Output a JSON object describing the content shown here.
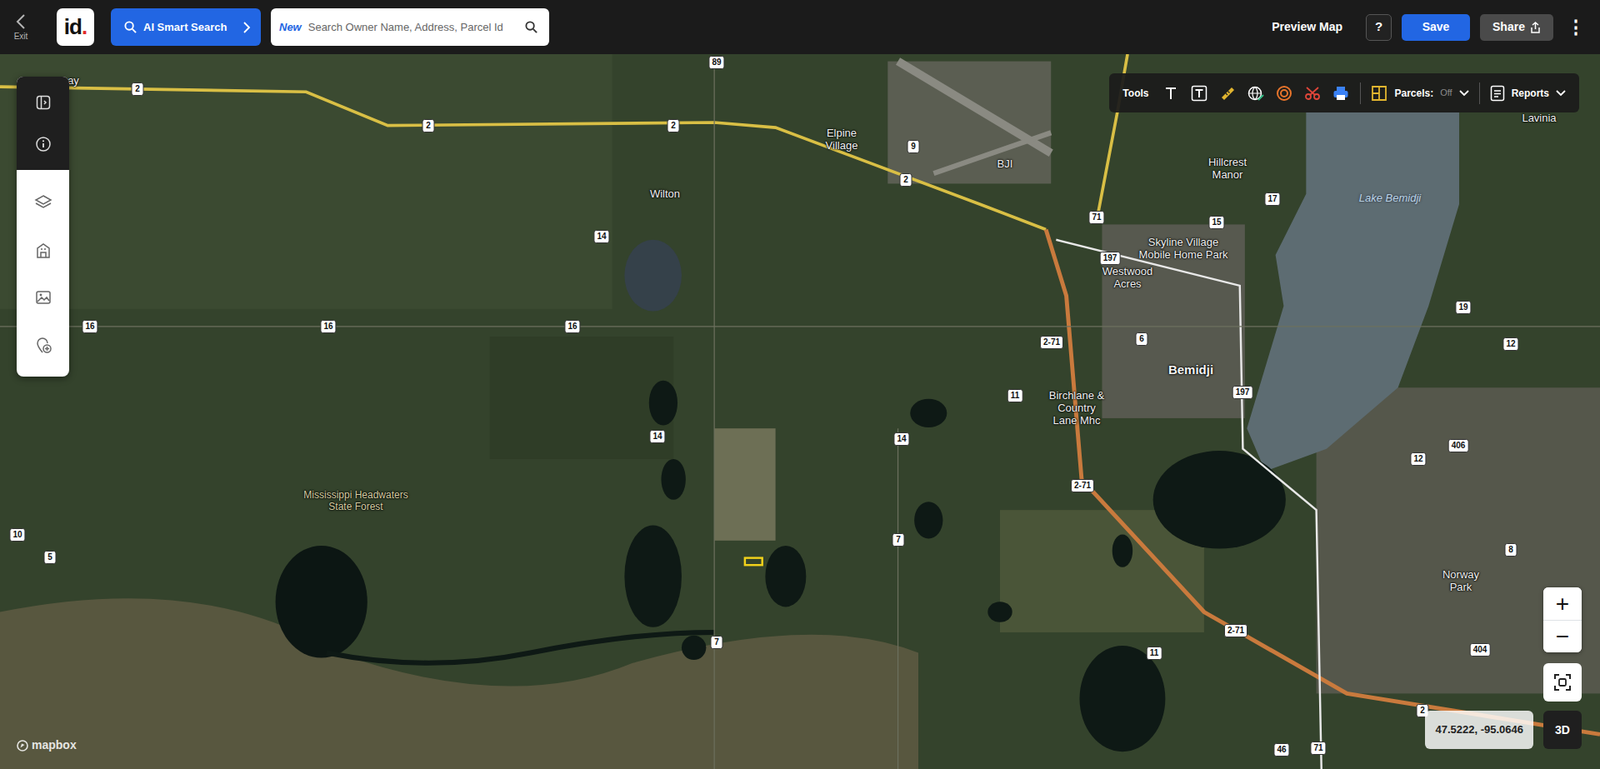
{
  "topbar": {
    "exit": "Exit",
    "logo": {
      "name": "id",
      "dot": "."
    },
    "ai_search": "AI Smart Search",
    "search": {
      "badge": "New",
      "placeholder": "Search Owner Name, Address, Parcel Id"
    },
    "preview": "Preview Map",
    "help": "?",
    "save": "Save",
    "share": "Share",
    "more": "⋮"
  },
  "tools": {
    "label": "Tools",
    "parcels": {
      "label": "Parcels:",
      "value": "Off"
    },
    "reports": "Reports"
  },
  "map": {
    "places": [
      {
        "text": "ay",
        "kind": "town"
      },
      {
        "text": "Wilton",
        "kind": "town"
      },
      {
        "text": "Elpine Village",
        "kind": "town"
      },
      {
        "text": "BJI",
        "kind": "town"
      },
      {
        "text": "Hillcrest Manor",
        "kind": "town"
      },
      {
        "text": "Lake Bemidji",
        "kind": "water"
      },
      {
        "text": "Lavinia",
        "kind": "town"
      },
      {
        "text": "Skyline Village Mobile Home Park",
        "kind": "town"
      },
      {
        "text": "Westwood Acres",
        "kind": "town"
      },
      {
        "text": "Bemidji",
        "kind": "city"
      },
      {
        "text": "Birchlane & Country Lane Mhc",
        "kind": "town"
      },
      {
        "text": "Mississippi Headwaters State Forest",
        "kind": "forest"
      },
      {
        "text": "Norway Park",
        "kind": "town"
      }
    ],
    "shields": [
      "2",
      "2",
      "2",
      "89",
      "9",
      "2",
      "71",
      "197",
      "15",
      "17",
      "14",
      "16",
      "16",
      "16",
      "6",
      "2-71",
      "11",
      "197",
      "19",
      "12",
      "14",
      "14",
      "406",
      "12",
      "2-71",
      "7",
      "8",
      "10",
      "5",
      "2-71",
      "7",
      "11",
      "404",
      "2",
      "46",
      "71"
    ],
    "coordinates": "47.5222, -95.0646",
    "attribution": "mapbox"
  },
  "controls": {
    "zoom_in": "+",
    "zoom_out": "−",
    "three_d": "3D"
  }
}
